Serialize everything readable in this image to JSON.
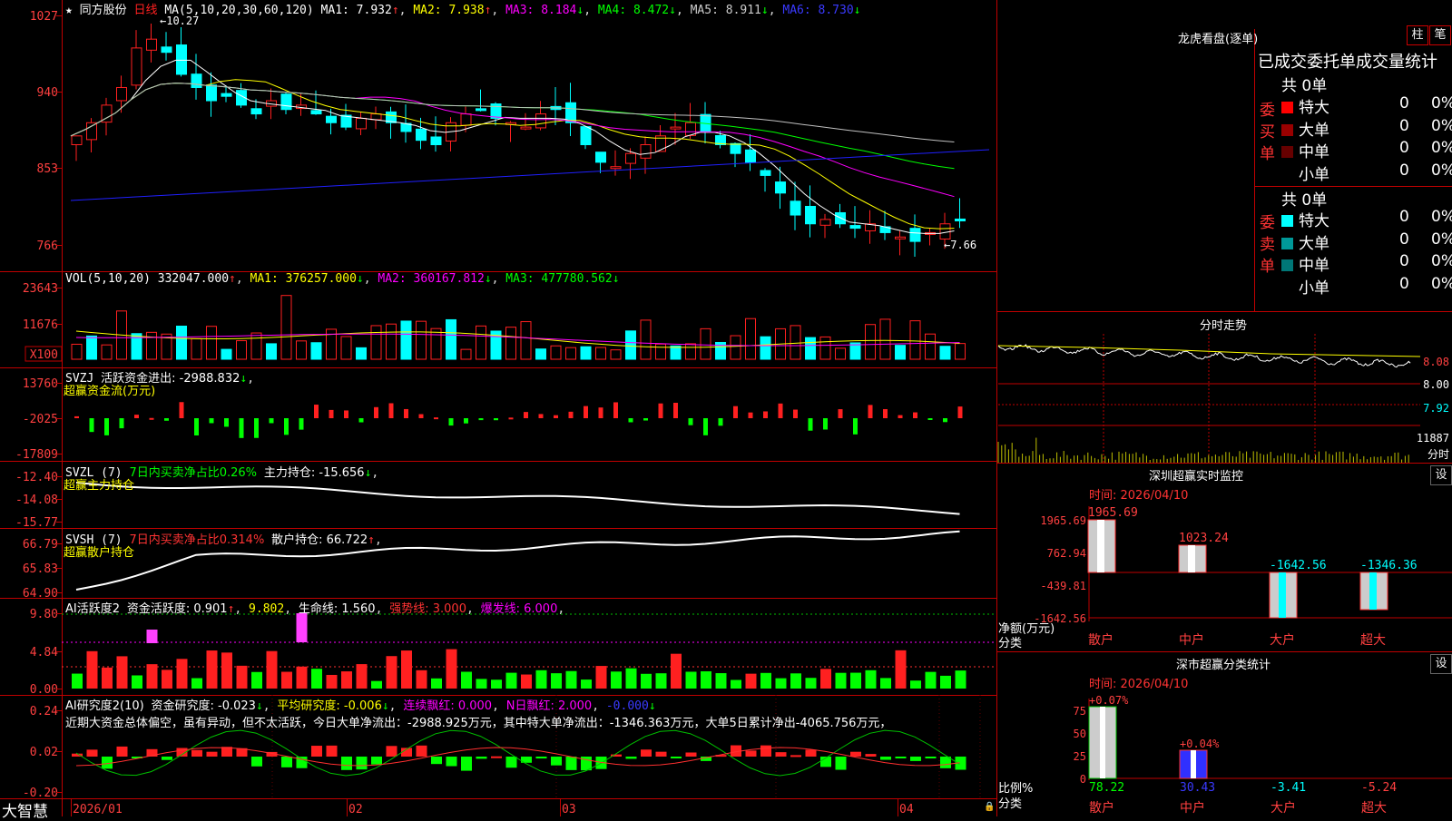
{
  "app": {
    "brand": "大智慧",
    "stock_name": "同方股份",
    "period_label": "日线"
  },
  "kline": {
    "ma_label": "MA(5,10,20,30,60,120)",
    "ma1": "MA1: 7.932",
    "ma2": "MA2: 7.938",
    "ma3": "MA3: 8.184",
    "ma4": "MA4: 8.472",
    "ma5": "MA5: 8.911",
    "ma6": "MA6: 8.730",
    "y_ticks": [
      "1027",
      "940",
      "853",
      "766"
    ],
    "high_mark": "10.27",
    "low_mark": "7.66"
  },
  "vol": {
    "label": "VOL(5,10,20)",
    "value": "332047.000",
    "ma1": "MA1: 376257.000",
    "ma2": "MA2: 360167.812",
    "ma3": "MA3: 477780.562",
    "y_ticks": [
      "23643",
      "11676",
      "X100"
    ]
  },
  "svzj": {
    "label": "SVZJ",
    "title": "活跃资金进出: -2988.832",
    "subtitle": "超赢资金流(万元)",
    "y_ticks": [
      "13760",
      "-2025",
      "-17809"
    ]
  },
  "svzl": {
    "label": "SVZL (7)",
    "ratio": "7日内买卖净占比0.26%",
    "hold": "主力持仓: -15.656",
    "subtitle": "超赢主力持仓",
    "y_ticks": [
      "-12.40",
      "-14.08",
      "-15.77"
    ]
  },
  "svsh": {
    "label": "SVSH (7)",
    "ratio": "7日内买卖净占比0.314%",
    "hold": "散户持仓: 66.722",
    "subtitle": "超赢散户持仓",
    "y_ticks": [
      "66.79",
      "65.83",
      "64.90"
    ]
  },
  "ai1": {
    "label": "AI活跃度2",
    "active": "资金活跃度: 0.901",
    "v2": "9.802",
    "life": "生命线: 1.560",
    "strong": "强势线: 3.000",
    "burst": "爆发线: 6.000",
    "y_ticks": [
      "9.80",
      "4.84",
      "0.00"
    ]
  },
  "ai2": {
    "label": "AI研究度2(10)",
    "research": "资金研究度: -0.023",
    "avg": "平均研究度: -0.006",
    "red": "连续飘红: 0.000",
    "nred": "N日飘红: 2.000",
    "last": "-0.000",
    "y_ticks": [
      "0.24",
      "0.02",
      "-0.20"
    ],
    "comment": "近期大资金总体偏空，虽有异动，但不太活跃，今日大单净流出：-2988.925万元，其中特大单净流出：-1346.363万元，大单5日累计净出-4065.756万元，"
  },
  "x_axis": [
    "2026/01",
    "02",
    "03",
    "04"
  ],
  "right": {
    "dragon_title": "龙虎看盘(逐单)",
    "btn_bar": "柱",
    "btn_pen": "笔",
    "tabs_title": "已成交委托单成交量统计",
    "buy_label": "委买单",
    "sell_label": "委卖单",
    "buy_total": "共 0单",
    "sell_total": "共 0单",
    "rows_buy": [
      {
        "name": "特大",
        "val": "0",
        "pct": "0%",
        "color": "#ff0000"
      },
      {
        "name": "大单",
        "val": "0",
        "pct": "0%",
        "color": "#990000"
      },
      {
        "name": "中单",
        "val": "0",
        "pct": "0%",
        "color": "#660000"
      },
      {
        "name": "小单",
        "val": "0",
        "pct": "0%",
        "color": "#000000"
      }
    ],
    "rows_sell": [
      {
        "name": "特大",
        "val": "0",
        "pct": "0%",
        "color": "#00ffff"
      },
      {
        "name": "大单",
        "val": "0",
        "pct": "0%",
        "color": "#009999"
      },
      {
        "name": "中单",
        "val": "0",
        "pct": "0%",
        "color": "#007777"
      },
      {
        "name": "小单",
        "val": "0",
        "pct": "0%",
        "color": "#000000"
      }
    ],
    "intraday_title": "分时走势",
    "intraday_ticks": [
      "8.08",
      "8.00",
      "7.92"
    ],
    "intraday_vol": "11887",
    "intraday_vol_unit": "分时",
    "sz_monitor_title": "深圳超赢实时监控",
    "sz_monitor_set": "设",
    "sz_time": "时间: 2026/04/10",
    "sz_ticks": [
      "1965.69",
      "762.94",
      "-439.81",
      "-1642.56"
    ],
    "sz_unit": "净额(万元)",
    "sz_cat_label": "分类",
    "sz_categories": [
      "散户",
      "中户",
      "大户",
      "超大"
    ],
    "sz_values": [
      "1965.69",
      "1023.24",
      "-1642.56",
      "-1346.36"
    ],
    "class_title": "深市超赢分类统计",
    "class_set": "设",
    "class_time": "时间: 2026/04/10",
    "class_ticks": [
      "75",
      "50",
      "25",
      "0"
    ],
    "class_unit": "比例%",
    "class_cat_label": "分类",
    "class_categories": [
      "散户",
      "中户",
      "大户",
      "超大"
    ],
    "class_values": [
      "78.22",
      "30.43",
      "-3.41",
      "-5.24"
    ],
    "class_tops": [
      "+0.07%",
      "+0.04%"
    ]
  },
  "colors": {
    "up": "#ff2020",
    "down": "#00ffff",
    "ma1": "#ffffff",
    "ma2": "#ffff00",
    "ma3": "#ff00ff",
    "ma4": "#00ff00",
    "ma5": "#c0c0c0",
    "ma6": "#2020ff",
    "grid": "#c00000"
  }
}
